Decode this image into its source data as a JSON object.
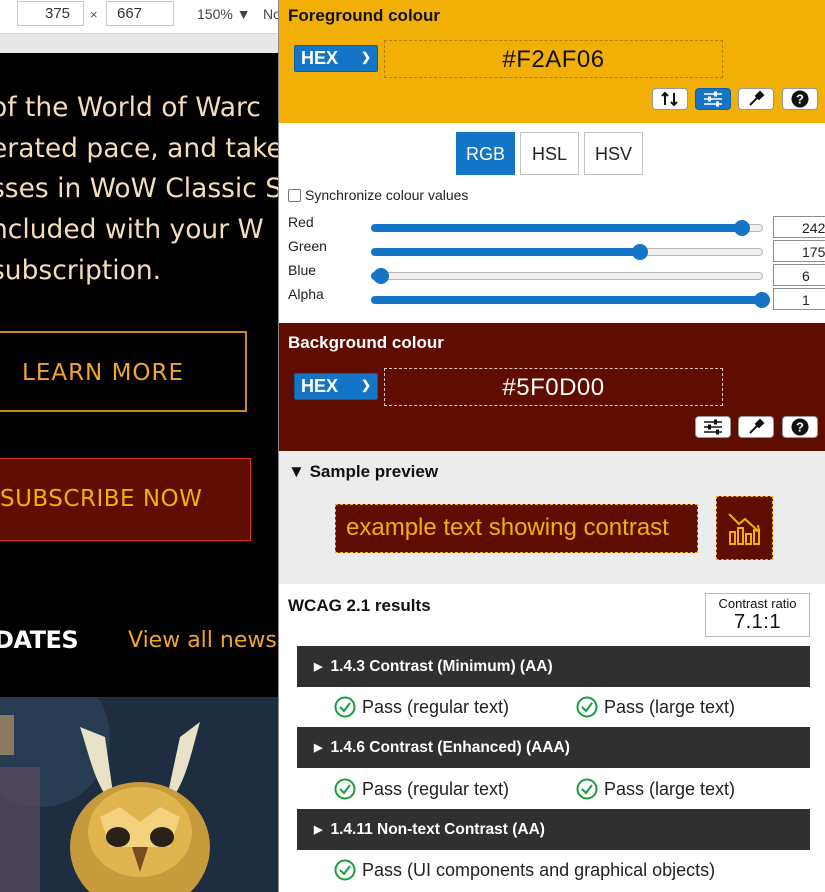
{
  "devtools": {
    "width_value": "375",
    "height_value": "667",
    "times": "×",
    "zoom": "150% ▼",
    "throttle": "No"
  },
  "site": {
    "intro_lines": [
      "of the World of Warc",
      "erated pace, and take",
      "sses in WoW Classic S",
      "ncluded with your W",
      " subscription."
    ],
    "learn_more": "LEARN MORE",
    "subscribe": "SUBSCRIBE NOW",
    "updates_heading": "DATES",
    "view_all": "View all news"
  },
  "foreground": {
    "title": "Foreground colour",
    "format": "HEX",
    "hex": "#F2AF06",
    "color": "#F2AF06",
    "tools": [
      "swap-icon",
      "sliders-icon",
      "eyedropper-icon",
      "help-icon"
    ]
  },
  "modes": [
    "RGB",
    "HSL",
    "HSV"
  ],
  "active_mode": "RGB",
  "sync_label": "Synchronize colour values",
  "sliders": [
    {
      "label": "Red",
      "value": "242",
      "fraction": 0.949
    },
    {
      "label": "Green",
      "value": "175",
      "fraction": 0.686
    },
    {
      "label": "Blue",
      "value": "6",
      "fraction": 0.024
    },
    {
      "label": "Alpha",
      "value": "1",
      "fraction": 1.0
    }
  ],
  "background": {
    "title": "Background colour",
    "format": "HEX",
    "hex": "#5F0D00",
    "color": "#5F0D00",
    "tools": [
      "sliders-icon",
      "eyedropper-icon",
      "help-icon"
    ]
  },
  "preview": {
    "title": "Sample preview",
    "toggle": "▼",
    "sample_text": "example text showing contrast",
    "icon": "chart-icon"
  },
  "results": {
    "title": "WCAG 2.1 results",
    "ratio_label": "Contrast ratio",
    "ratio": "7.1:1",
    "criteria": [
      {
        "title": "1.4.3 Contrast (Minimum) (AA)",
        "results": [
          "Pass (regular text)",
          "Pass (large text)"
        ]
      },
      {
        "title": "1.4.6 Contrast (Enhanced) (AAA)",
        "results": [
          "Pass (regular text)",
          "Pass (large text)"
        ]
      },
      {
        "title": "1.4.11 Non-text Contrast (AA)",
        "results": [
          "Pass (UI components and graphical objects)"
        ]
      }
    ],
    "pass_color": "#1a9c3e"
  },
  "colors": {
    "accent_blue": "#1474C6",
    "criterion_bar": "#303030",
    "site_link": "#F0A431"
  }
}
